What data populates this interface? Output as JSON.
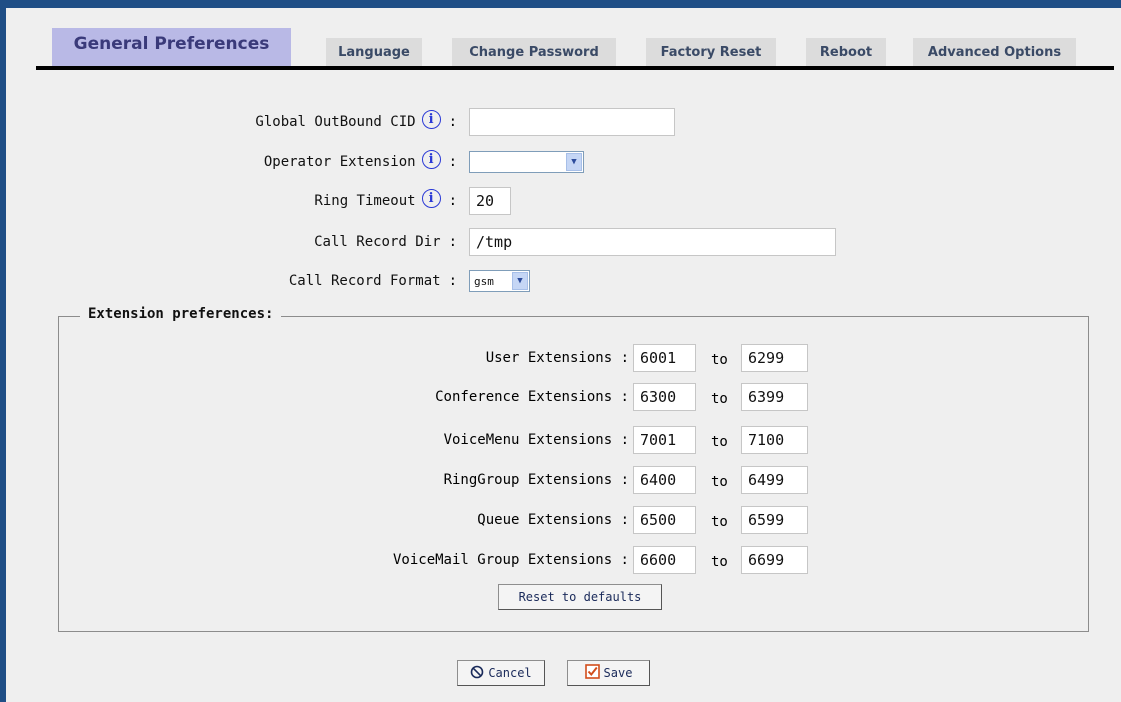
{
  "tabs": [
    {
      "label": "General Preferences",
      "active": true
    },
    {
      "label": "Language"
    },
    {
      "label": "Change Password"
    },
    {
      "label": "Factory Reset"
    },
    {
      "label": "Reboot"
    },
    {
      "label": "Advanced Options"
    }
  ],
  "general": {
    "outbound_cid_label": "Global OutBound CID",
    "outbound_cid_value": "",
    "operator_ext_label": "Operator Extension",
    "operator_ext_value": "",
    "ring_timeout_label": "Ring Timeout",
    "ring_timeout_value": "20",
    "record_dir_label": "Call Record Dir",
    "record_dir_value": "/tmp",
    "record_format_label": "Call Record Format",
    "record_format_value": "gsm",
    "colon": ":",
    "info_icon_glyph": "i"
  },
  "extensions": {
    "legend": "Extension preferences:",
    "to_label": "to",
    "rows": [
      {
        "label": "User Extensions :",
        "from": "6001",
        "to": "6299"
      },
      {
        "label": "Conference Extensions :",
        "from": "6300",
        "to": "6399"
      },
      {
        "label": "VoiceMenu Extensions :",
        "from": "7001",
        "to": "7100"
      },
      {
        "label": "RingGroup Extensions :",
        "from": "6400",
        "to": "6499"
      },
      {
        "label": "Queue Extensions :",
        "from": "6500",
        "to": "6599"
      },
      {
        "label": "VoiceMail Group Extensions :",
        "from": "6600",
        "to": "6699"
      }
    ],
    "reset_label": "Reset to defaults"
  },
  "actions": {
    "cancel_label": "Cancel",
    "save_label": "Save"
  },
  "colors": {
    "border_blue": "#1f4e86",
    "active_tab": "#b9b9e6",
    "info_icon": "#2a39d6"
  },
  "icons": {
    "cancel": "cancel-circle-icon",
    "save": "checkbox-check-icon",
    "select_arrow": "chevron-down-icon"
  }
}
